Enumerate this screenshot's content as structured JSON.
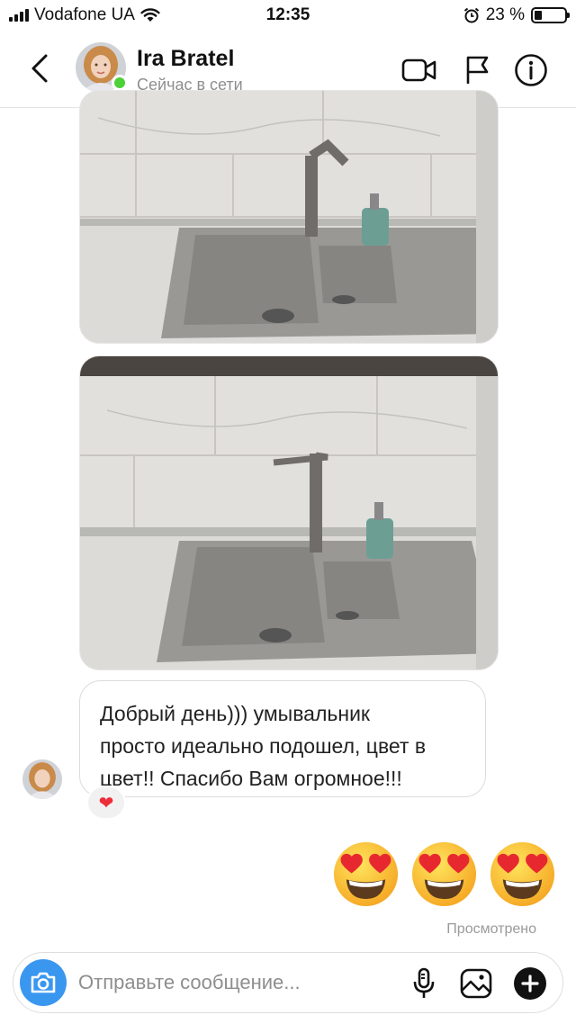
{
  "status_bar": {
    "carrier": "Vodafone UA",
    "time": "12:35",
    "battery": "23 %",
    "battery_level": 0.23
  },
  "header": {
    "contact_name": "Ira Bratel",
    "contact_status": "Сейчас в сети",
    "icons": [
      "back-chevron-icon",
      "video-camera-icon",
      "flag-icon",
      "info-icon"
    ]
  },
  "messages": [
    {
      "type": "photo",
      "from": "contact"
    },
    {
      "type": "photo",
      "from": "contact"
    },
    {
      "type": "text",
      "from": "contact",
      "lines": [
        "Добрый день))) умывальник",
        "просто идеально подошел, цвет в",
        "цвет!! Спасибо Вам огромное!!!"
      ],
      "reaction": "❤"
    },
    {
      "type": "emoji",
      "from": "me",
      "emoji": [
        "😍",
        "😍",
        "😍"
      ]
    }
  ],
  "seen_label": "Просмотрено",
  "composer": {
    "placeholder": "Отправьте сообщение...",
    "icons": [
      "camera-icon",
      "microphone-icon",
      "gallery-icon",
      "plus-icon"
    ]
  },
  "colors": {
    "accent_blue": "#3a97f0",
    "online_green": "#4cd137",
    "heart_red": "#ed2d3a"
  }
}
